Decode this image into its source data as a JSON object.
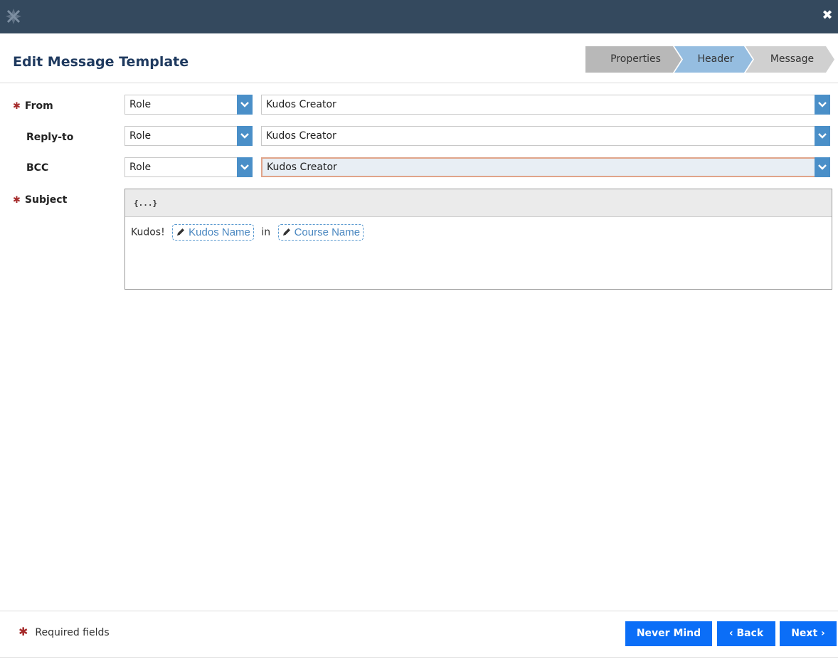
{
  "window": {
    "logo_icon": "star-cross-logo-icon",
    "close_icon": "close-icon",
    "close_symbol": "✖"
  },
  "page": {
    "title": "Edit Message Template"
  },
  "wizard": {
    "steps": [
      {
        "label": "Properties"
      },
      {
        "label": "Header"
      },
      {
        "label": "Message"
      }
    ],
    "active_step": "Header"
  },
  "form": {
    "from": {
      "label": "From",
      "required": true,
      "type_value": "Role",
      "recipient_value": "Kudos Creator"
    },
    "reply_to": {
      "label": "Reply-to",
      "required": false,
      "type_value": "Role",
      "recipient_value": "Kudos Creator"
    },
    "bcc": {
      "label": "BCC",
      "required": false,
      "type_value": "Role",
      "recipient_value": "Kudos Creator"
    },
    "subject": {
      "label": "Subject",
      "required": true,
      "toolbar_token_label": "{...}",
      "text_prefix": "Kudos!",
      "token_1": "Kudos Name",
      "text_between": "in",
      "token_2": "Course Name"
    }
  },
  "footer": {
    "required_note": "Required fields",
    "required_marker": "✱",
    "buttons": {
      "never_mind": "Never Mind",
      "back": "‹ Back",
      "next": "Next ›"
    }
  },
  "colors": {
    "topbar": "#34495e",
    "primary_button": "#0b6ef7",
    "step_active": "#95bde0",
    "required_marker": "#a52a2a",
    "focus_border": "#e0a48a"
  }
}
